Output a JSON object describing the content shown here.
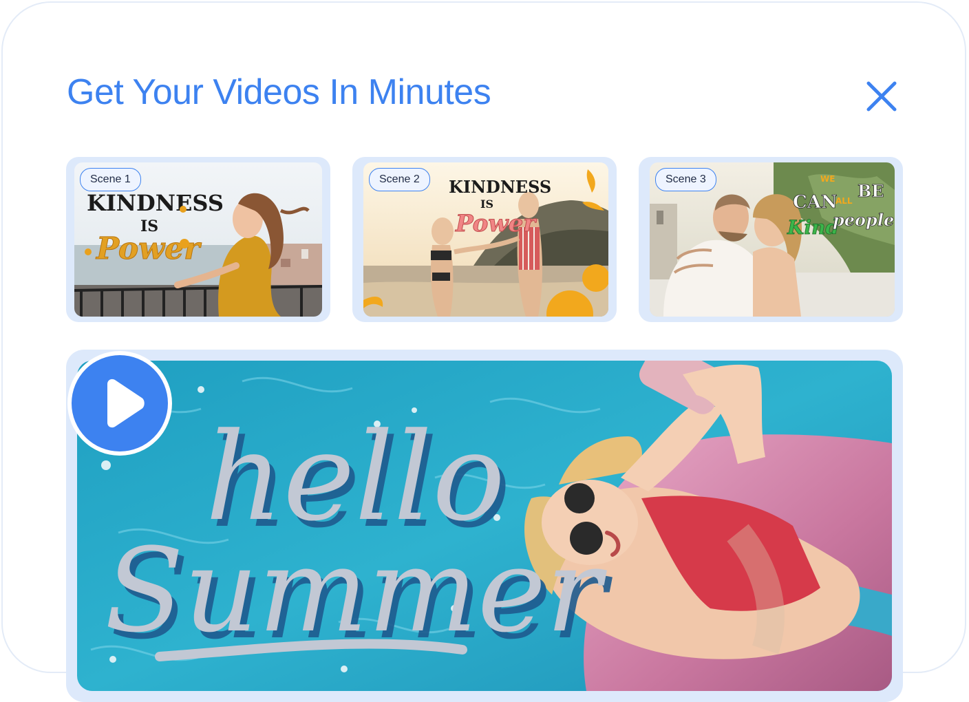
{
  "header": {
    "title": "Get Your Videos In Minutes"
  },
  "icons": {
    "close": "close-icon",
    "play": "play-icon"
  },
  "colors": {
    "accent": "#3d82f0",
    "panel": "#dde9fb",
    "pool": "#2aa6c6"
  },
  "scenes": [
    {
      "label": "Scene 1",
      "lettering": [
        "KINDNESS",
        "IS",
        "Power"
      ]
    },
    {
      "label": "Scene 2",
      "lettering": [
        "KINDNESS",
        "IS",
        "Power"
      ]
    },
    {
      "label": "Scene 3",
      "lettering": [
        "WE",
        "CAN",
        "ALL",
        "BE",
        "Kind",
        "people"
      ]
    }
  ],
  "preview": {
    "lettering": [
      "hello",
      "Summer"
    ]
  }
}
